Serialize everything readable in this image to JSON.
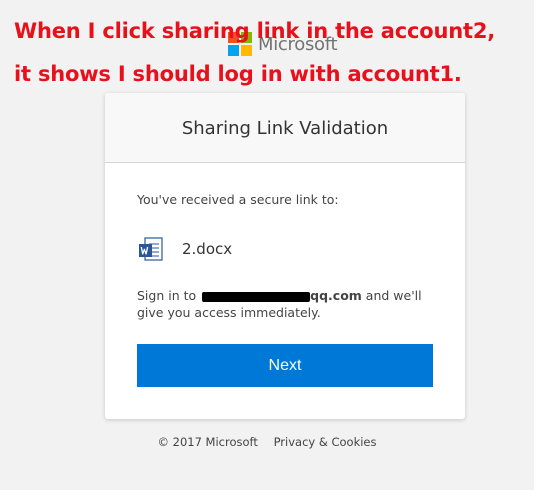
{
  "brand": {
    "logo_text": "Microsoft",
    "colors": [
      "#f25022",
      "#7fba00",
      "#00a4ef",
      "#ffb900"
    ]
  },
  "annotation": {
    "line1": "When I click sharing link in the account2,",
    "line2": "it shows I should log in with account1.",
    "color": "#e8111b"
  },
  "card": {
    "title": "Sharing Link Validation",
    "received_text": "You've received a secure link to:",
    "file": {
      "name": "2.docx",
      "icon": "word-document-icon"
    },
    "signin": {
      "prefix": "Sign in to ",
      "email_visible_suffix": "qq.com",
      "suffix": " and we'll give you access immediately."
    },
    "next_button": "Next",
    "accent_color": "#0078d7"
  },
  "footer": {
    "copyright": "© 2017 Microsoft",
    "privacy_link": "Privacy & Cookies"
  }
}
